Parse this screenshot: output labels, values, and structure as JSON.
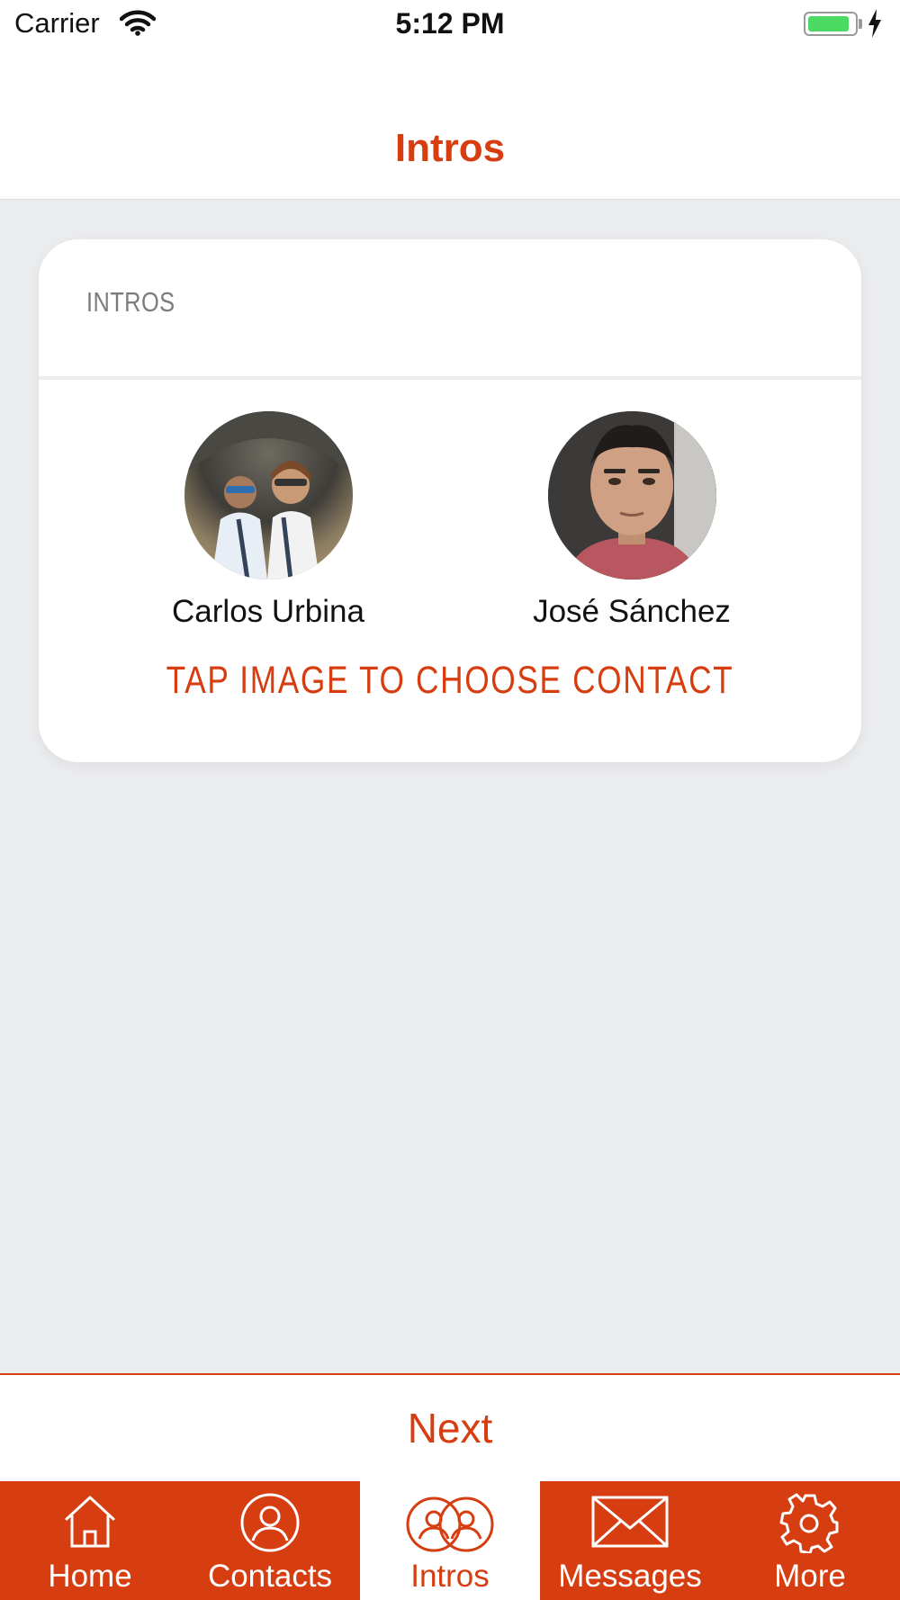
{
  "status_bar": {
    "carrier": "Carrier",
    "time": "5:12 PM",
    "battery_level": 0.9
  },
  "nav": {
    "title": "Intros"
  },
  "card": {
    "heading": "INTROS",
    "contacts": [
      {
        "name": "Carlos Urbina"
      },
      {
        "name": "José Sánchez"
      }
    ],
    "hint": "TAP IMAGE TO CHOOSE CONTACT"
  },
  "next_button": {
    "label": "Next"
  },
  "tab_bar": {
    "tabs": [
      {
        "label": "Home",
        "icon": "home-icon"
      },
      {
        "label": "Contacts",
        "icon": "contacts-icon"
      },
      {
        "label": "Intros",
        "icon": "intros-icon",
        "active": true
      },
      {
        "label": "Messages",
        "icon": "envelope-icon"
      },
      {
        "label": "More",
        "icon": "gear-icon"
      }
    ]
  },
  "colors": {
    "accent": "#d63d10",
    "background": "#ebecee",
    "battery": "#4cd964"
  }
}
